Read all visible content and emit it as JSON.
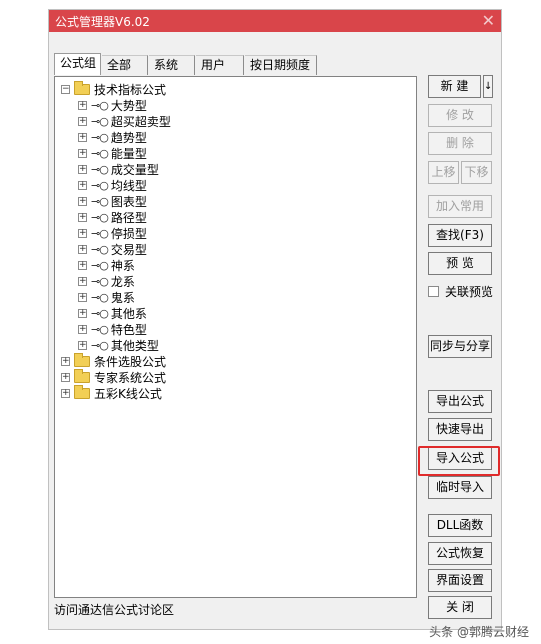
{
  "window": {
    "title": "公式管理器V6.02"
  },
  "tabs": [
    "公式组",
    "全部",
    "系统",
    "用户",
    "按日期频度"
  ],
  "tree": {
    "root_groups": [
      {
        "label": "技术指标公式",
        "children": [
          "大势型",
          "超买超卖型",
          "趋势型",
          "能量型",
          "成交量型",
          "均线型",
          "图表型",
          "路径型",
          "停损型",
          "交易型",
          "神系",
          "龙系",
          "鬼系",
          "其他系",
          "特色型",
          "其他类型"
        ]
      },
      {
        "label": "条件选股公式"
      },
      {
        "label": "专家系统公式"
      },
      {
        "label": "五彩K线公式"
      }
    ]
  },
  "buttons": {
    "new": "新 建",
    "new_dropdown": "↓",
    "edit": "修 改",
    "delete": "删 除",
    "move_up": "上移",
    "move_down": "下移",
    "add_common": "加入常用",
    "find": "查找(F3)",
    "preview": "预 览",
    "link_preview": "关联预览",
    "sync_share": "同步与分享",
    "export": "导出公式",
    "quick_export": "快速导出",
    "import": "导入公式",
    "temp_import": "临时导入",
    "dll": "DLL函数",
    "restore": "公式恢复",
    "ui_settings": "界面设置",
    "close": "关 闭"
  },
  "footer": {
    "forum": "访问通达信公式讨论区"
  },
  "watermark": "头条 @郭腾云财经"
}
